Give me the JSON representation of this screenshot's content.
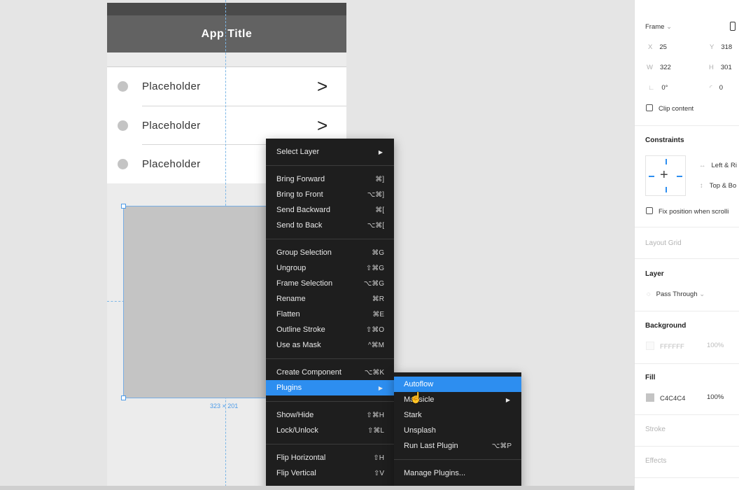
{
  "canvas": {
    "app_title": "App Title",
    "list_items": [
      {
        "label": "Placeholder",
        "chevron": ">"
      },
      {
        "label": "Placeholder",
        "chevron": ">"
      },
      {
        "label": "Placeholder",
        "chevron": ">"
      }
    ],
    "selection_size": "323 × 201"
  },
  "context_menu": {
    "groups": [
      [
        {
          "label": "Select Layer",
          "shortcut": "",
          "submenu": true
        }
      ],
      [
        {
          "label": "Bring Forward",
          "shortcut": "⌘]"
        },
        {
          "label": "Bring to Front",
          "shortcut": "⌥⌘]"
        },
        {
          "label": "Send Backward",
          "shortcut": "⌘["
        },
        {
          "label": "Send to Back",
          "shortcut": "⌥⌘["
        }
      ],
      [
        {
          "label": "Group Selection",
          "shortcut": "⌘G"
        },
        {
          "label": "Ungroup",
          "shortcut": "⇧⌘G"
        },
        {
          "label": "Frame Selection",
          "shortcut": "⌥⌘G"
        },
        {
          "label": "Rename",
          "shortcut": "⌘R"
        },
        {
          "label": "Flatten",
          "shortcut": "⌘E"
        },
        {
          "label": "Outline Stroke",
          "shortcut": "⇧⌘O"
        },
        {
          "label": "Use as Mask",
          "shortcut": "^⌘M"
        }
      ],
      [
        {
          "label": "Create Component",
          "shortcut": "⌥⌘K"
        },
        {
          "label": "Plugins",
          "shortcut": "",
          "submenu": true,
          "active": true
        }
      ],
      [
        {
          "label": "Show/Hide",
          "shortcut": "⇧⌘H"
        },
        {
          "label": "Lock/Unlock",
          "shortcut": "⇧⌘L"
        }
      ],
      [
        {
          "label": "Flip Horizontal",
          "shortcut": "⇧H"
        },
        {
          "label": "Flip Vertical",
          "shortcut": "⇧V"
        }
      ]
    ]
  },
  "plugins_submenu": {
    "items": [
      {
        "label": "Autoflow",
        "shortcut": "",
        "active": true
      },
      {
        "label": "Mapsicle",
        "shortcut": "",
        "submenu": true
      },
      {
        "label": "Stark",
        "shortcut": ""
      },
      {
        "label": "Unsplash",
        "shortcut": ""
      },
      {
        "label": "Run Last Plugin",
        "shortcut": "⌥⌘P"
      }
    ],
    "manage": "Manage Plugins..."
  },
  "panel": {
    "frame_label": "Frame",
    "x_label": "X",
    "x_value": "25",
    "y_label": "Y",
    "y_value": "318",
    "w_label": "W",
    "w_value": "322",
    "h_label": "H",
    "h_value": "301",
    "rotation_value": "0°",
    "radius_value": "0",
    "clip_content": "Clip content",
    "constraints_title": "Constraints",
    "constraint_h": "Left & Ri",
    "constraint_v": "Top & Bo",
    "fix_position": "Fix position when scrolli",
    "layout_grid": "Layout Grid",
    "layer_title": "Layer",
    "blend_mode": "Pass Through",
    "background_title": "Background",
    "bg_hex": "FFFFFF",
    "bg_opacity": "100%",
    "fill_title": "Fill",
    "fill_hex": "C4C4C4",
    "fill_opacity": "100%",
    "stroke_title": "Stroke",
    "effects_title": "Effects"
  },
  "colors": {
    "accent": "#2d8ef0",
    "menu_bg": "#1e1e1e",
    "header_bg": "#626262",
    "fill": "#c4c4c4"
  }
}
